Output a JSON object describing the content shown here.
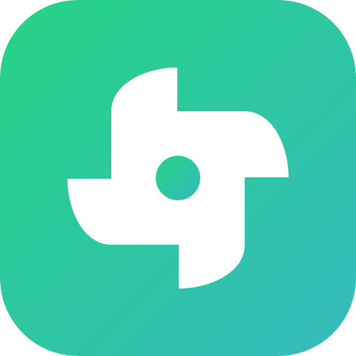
{
  "icon": {
    "name": "pinwheel-icon",
    "gradient_start": "#26D385",
    "gradient_end": "#35BBBE",
    "glyph_color": "#FFFFFF"
  }
}
